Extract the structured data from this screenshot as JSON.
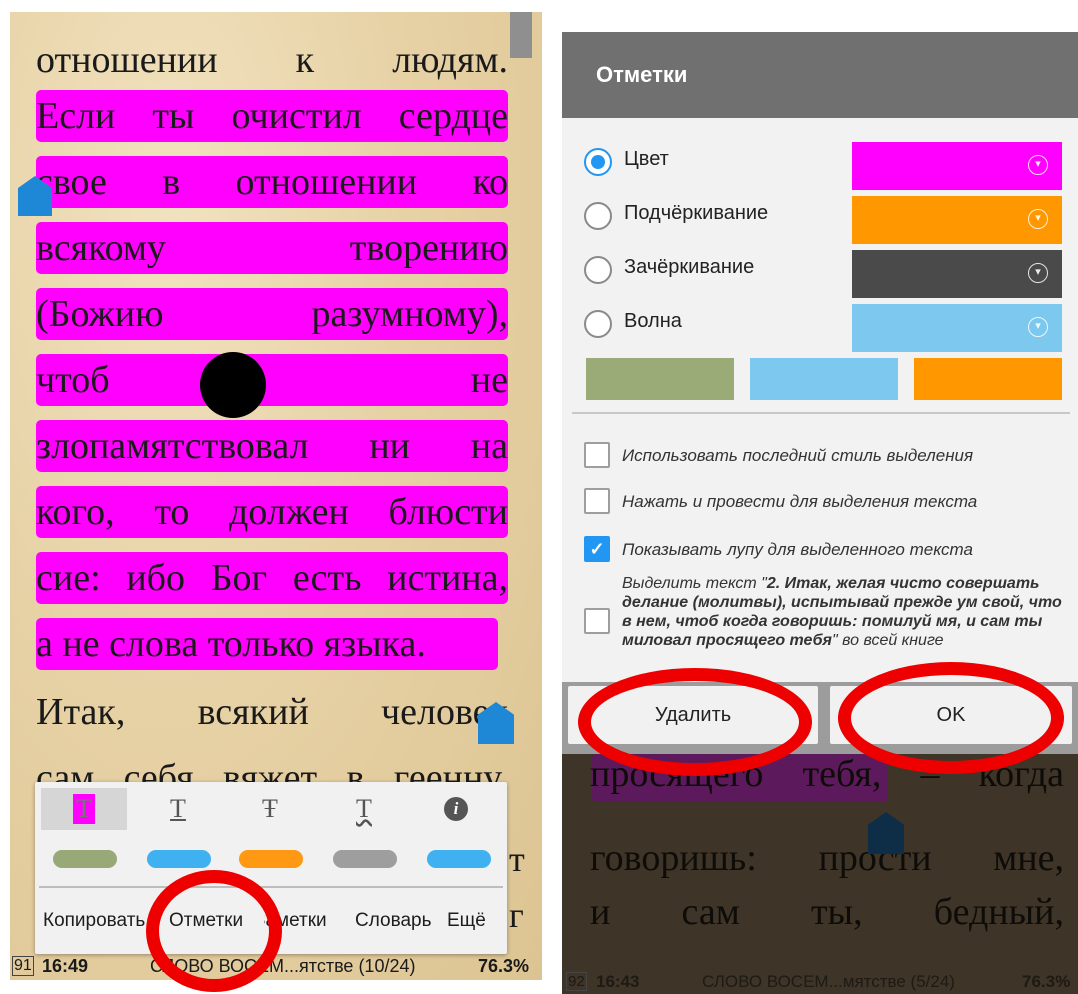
{
  "left": {
    "book_lines": [
      "отношении к людям.",
      "Если ты очистил сердце",
      "свое в отношении ко",
      "всякому творению",
      "(Божию разумному),",
      "чтоб не",
      "злопамятствовал ни на",
      "кого, то должен блюсти",
      "сие: ибо Бог есть истина,",
      "а не слова только языка.",
      "Итак, всякий человек",
      "сам себя вяжет в геенну,"
    ],
    "toolbar": {
      "icons": [
        "highlight-style-icon",
        "underline-style-icon",
        "strikethrough-style-icon",
        "wave-style-icon",
        "info-icon"
      ],
      "glyphs": {
        "highlight": "T",
        "underline": "T",
        "strike": "Ŧ",
        "wave": "T",
        "info": "i"
      },
      "swatch_colors": [
        "#98a877",
        "#3fb0f0",
        "#ff9812",
        "#9e9e9e",
        "#3fb0f0"
      ],
      "actions": [
        "Копировать",
        "Отметки",
        "Заметки",
        "Словарь",
        "Ещё"
      ],
      "stray_right_chars": [
        "т",
        "г"
      ]
    },
    "status": {
      "page": "91",
      "time": "16:49",
      "chapter": "СЛОВО ВОСЕМ...ятстве (10/24)",
      "percent": "76.3%"
    }
  },
  "right": {
    "dialog": {
      "title": "Отметки",
      "options": [
        {
          "label": "Цвет",
          "color": "#ff00ff",
          "selected": true
        },
        {
          "label": "Подчёркивание",
          "color": "#ff9800",
          "selected": false
        },
        {
          "label": "Зачёркивание",
          "color": "#4a4a4a",
          "selected": false
        },
        {
          "label": "Волна",
          "color": "#7cc8ee",
          "selected": false
        }
      ],
      "preset_colors": [
        "#9aab78",
        "#7cc8ee",
        "#ff9800"
      ],
      "checkboxes": [
        {
          "label": "Использовать последний стиль выделения",
          "checked": false
        },
        {
          "label": "Нажать и провести для выделения текста",
          "checked": false
        },
        {
          "label": "Показывать лупу для выделенного текста",
          "checked": true
        }
      ],
      "highlight_all": {
        "prefix": "Выделить текст \"",
        "quote": "2. Итак, желая чисто совершать делание (молитвы), испытывай прежде ум свой, что в нем, чтоб когда говоришь: помилуй мя, и сам ты миловал просящего тебя",
        "suffix": "\" во всей книге",
        "checked": false
      },
      "buttons": {
        "delete": "Удалить",
        "ok": "OK"
      }
    },
    "book_lines": [
      "просящего тебя, – когда",
      "говоришь: прости мне,",
      "и сам ты, бедный,"
    ],
    "status": {
      "page": "92",
      "time": "16:43",
      "chapter": "СЛОВО ВОСЕМ...мятстве (5/24)",
      "percent": "76.3%"
    }
  },
  "colors": {
    "highlight": "#ff00ff",
    "annotation_ring": "#ee0000",
    "selection_handle": "#1e88d6"
  }
}
